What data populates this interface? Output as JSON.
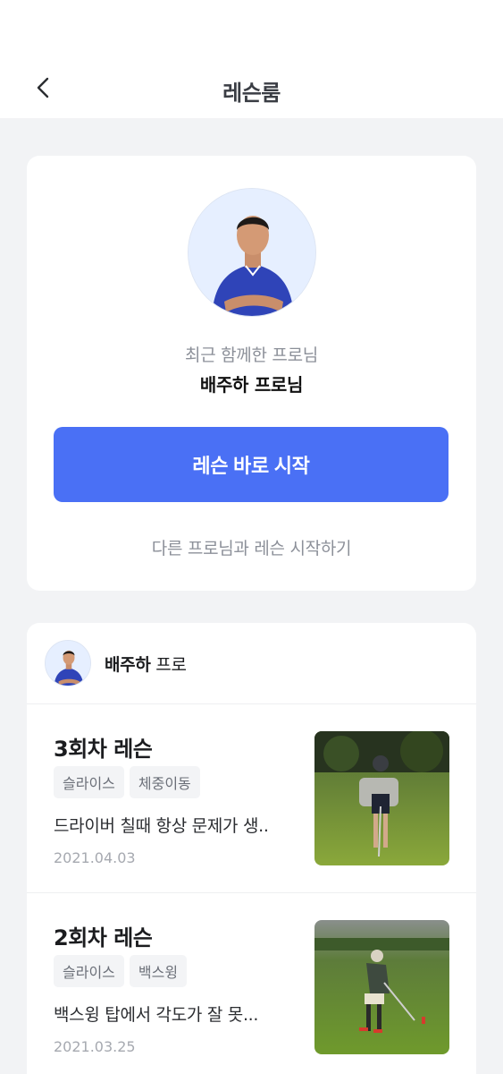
{
  "header": {
    "title": "레슨룸"
  },
  "pro_card": {
    "recent_label": "최근 함께한 프로님",
    "pro_name": "배주하 프로님",
    "start_button": "레슨 바로 시작",
    "other_link": "다른 프로님과 레슨 시작하기"
  },
  "lesson_list": {
    "pro_name": "배주하",
    "pro_suffix": " 프로",
    "items": [
      {
        "title": "3회차 레슨",
        "tags": [
          "슬라이스",
          "체중이동"
        ],
        "desc": "드라이버 칠때 항상 문제가 생..",
        "date": "2021.04.03"
      },
      {
        "title": "2회차 레슨",
        "tags": [
          "슬라이스",
          "백스윙"
        ],
        "desc": "백스윙 탑에서 각도가 잘 못...",
        "date": "2021.03.25"
      }
    ]
  },
  "colors": {
    "accent": "#4a70f5",
    "background": "#f2f3f5"
  }
}
